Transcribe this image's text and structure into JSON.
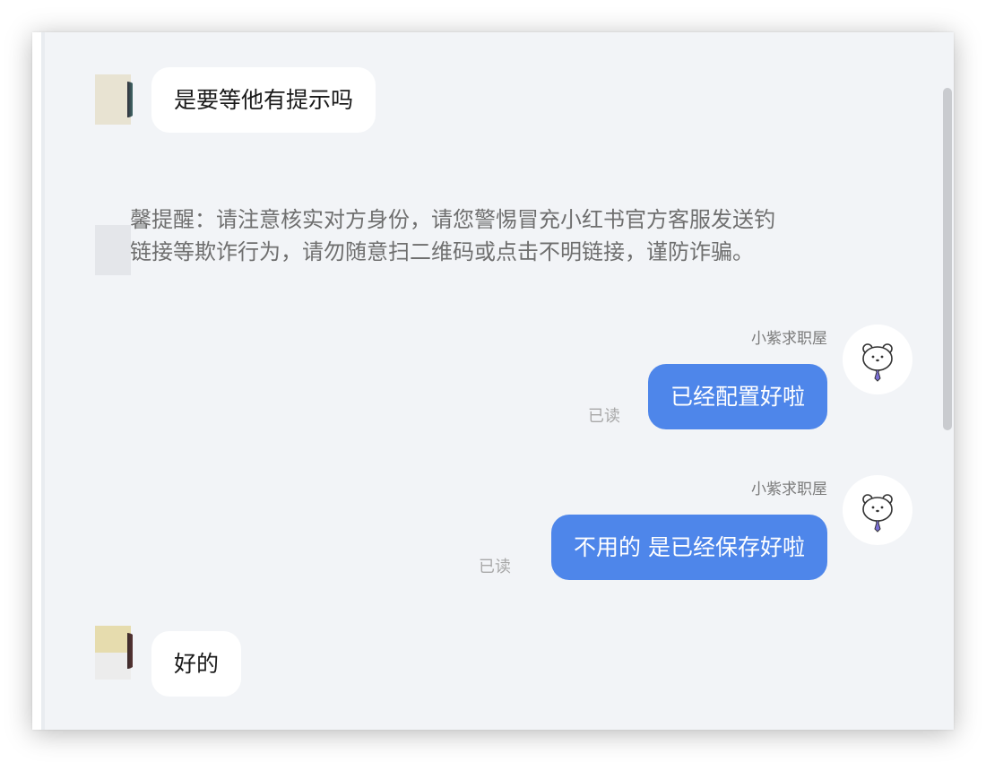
{
  "conversation": {
    "messages": [
      {
        "side": "left",
        "text": "是要等他有提示吗"
      },
      {
        "side": "system",
        "line1": "馨提醒：请注意核实对方身份，请您警惕冒充小红书官方客服发送钓",
        "line2": "链接等欺诈行为，请勿随意扫二维码或点击不明链接，谨防诈骗。"
      },
      {
        "side": "right",
        "sender": "小紫求职屋",
        "text": "已经配置好啦",
        "status": "已读"
      },
      {
        "side": "right",
        "sender": "小紫求职屋",
        "text": "不用的 是已经保存好啦",
        "status": "已读"
      },
      {
        "side": "left",
        "text": "好的"
      }
    ]
  },
  "icons": {
    "self_avatar": "bear-with-tie-icon",
    "peer_avatar": "blurred-avatar"
  },
  "colors": {
    "background": "#f2f4f7",
    "outgoing_bubble": "#4e86ea",
    "incoming_bubble": "#ffffff",
    "read_status": "#a8a8a8"
  }
}
